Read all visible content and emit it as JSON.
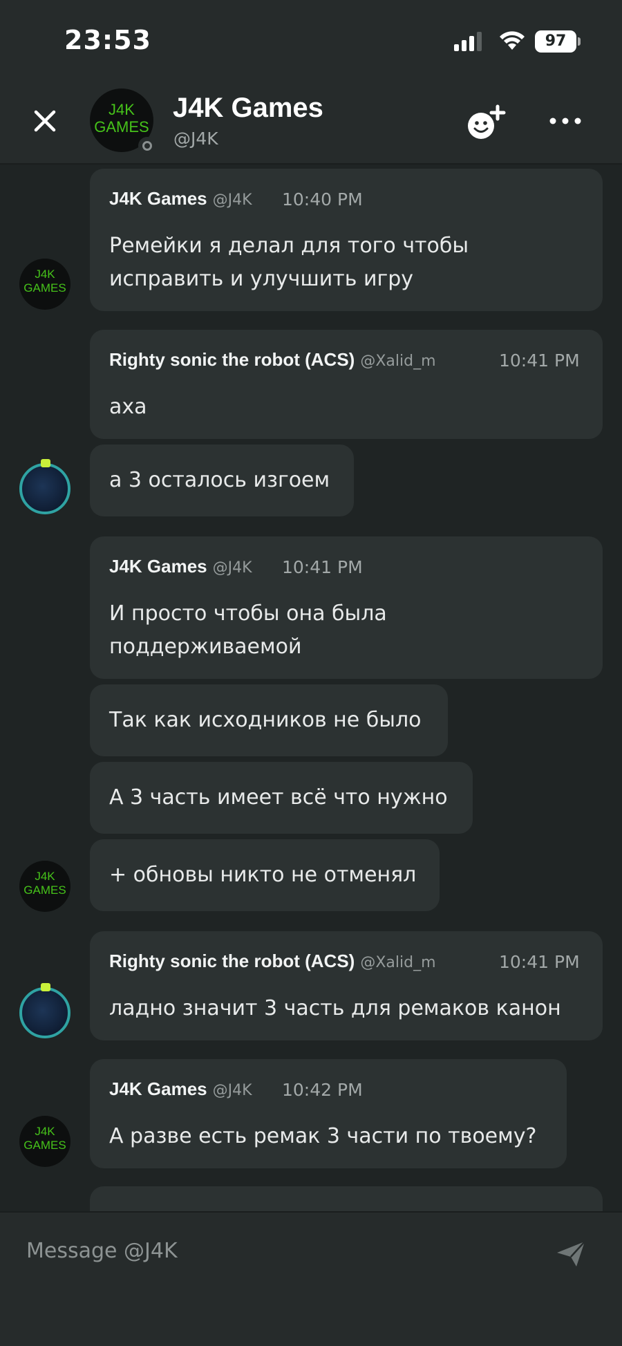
{
  "status_bar": {
    "time": "23:53",
    "battery": "97"
  },
  "header": {
    "name": "J4K Games",
    "handle": "@J4K",
    "avatar_line1": "J4K",
    "avatar_line2": "GAMES"
  },
  "messages": [
    {
      "author": "J4K Games",
      "handle": "@J4K",
      "time": "10:40 PM",
      "lines": [
        "Ремейки я делал для того чтобы",
        "исправить и улучшить игру"
      ]
    },
    {
      "author": "Righty sonic the robot (ACS)",
      "handle": "@Xalid_m",
      "time": "10:41 PM",
      "lines": [
        "аха"
      ]
    },
    {
      "text": "а 3 осталось изгоем"
    },
    {
      "author": "J4K Games",
      "handle": "@J4K",
      "time": "10:41 PM",
      "lines": [
        "И просто чтобы она была",
        "поддерживаемой"
      ]
    },
    {
      "text": "Так как исходников не было"
    },
    {
      "text": "А 3 часть имеет всё что нужно"
    },
    {
      "text": "+ обновы никто не отменял"
    },
    {
      "author": "Righty sonic the robot (ACS)",
      "handle": "@Xalid_m",
      "time": "10:41 PM",
      "lines": [
        "ладно значит 3 часть для ремаков канон"
      ]
    },
    {
      "author": "J4K Games",
      "handle": "@J4K",
      "time": "10:42 PM",
      "lines": [
        "А разве есть ремак 3 части по твоему?"
      ]
    }
  ],
  "composer": {
    "placeholder": "Message @J4K"
  },
  "icons": {
    "close": "close-icon",
    "add_friend": "add-friend-icon",
    "more": "more-icon",
    "send": "send-icon"
  }
}
